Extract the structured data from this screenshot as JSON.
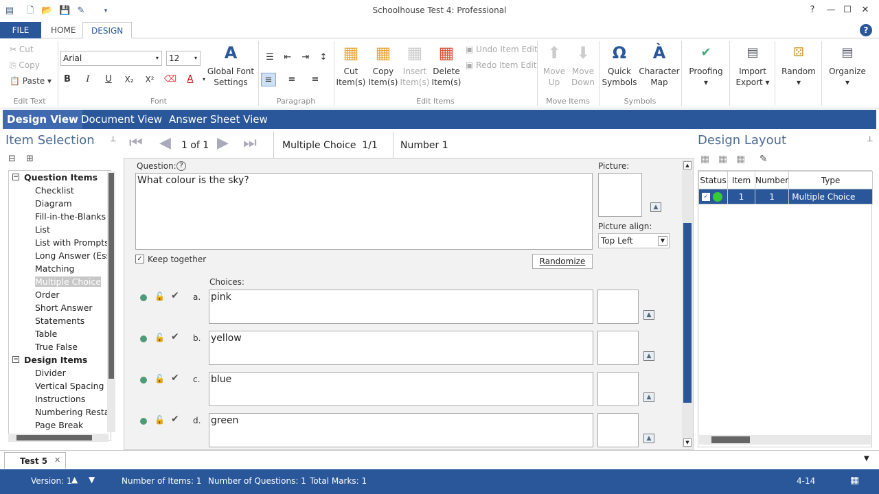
{
  "app": {
    "title": "Schoolhouse Test 4: Professional"
  },
  "ribbon_tabs": [
    "FILE",
    "HOME",
    "DESIGN"
  ],
  "ribbon": {
    "edit_text": {
      "label": "Edit Text",
      "cut": "Cut",
      "copy": "Copy",
      "paste": "Paste"
    },
    "font": {
      "label": "Font",
      "family": "Arial",
      "size": "12",
      "global_settings": "Global Font Settings"
    },
    "paragraph": {
      "label": "Paragraph"
    },
    "edit_items": {
      "label": "Edit Items",
      "cut": "Cut Item(s)",
      "copy": "Copy Item(s)",
      "insert": "Insert Item(s)",
      "delete": "Delete Item(s)",
      "undo": "Undo Item Edit",
      "redo": "Redo Item Edit"
    },
    "move_items": {
      "label": "Move Items",
      "up": "Move Up",
      "down": "Move Down"
    },
    "symbols": {
      "label": "Symbols",
      "quick": "Quick Symbols",
      "charmap": "Character Map"
    },
    "proofing": "Proofing",
    "import_export": "Import Export",
    "random": "Random",
    "organize": "Organize"
  },
  "view_tabs": [
    "Design View",
    "Document View",
    "Answer Sheet View"
  ],
  "item_selection": {
    "title": "Item Selection",
    "tree": [
      {
        "type": "cat",
        "label": "Question Items"
      },
      {
        "type": "leaf",
        "label": "Checklist"
      },
      {
        "type": "leaf",
        "label": "Diagram"
      },
      {
        "type": "leaf",
        "label": "Fill-in-the-Blanks"
      },
      {
        "type": "leaf",
        "label": "List"
      },
      {
        "type": "leaf",
        "label": "List with Prompts"
      },
      {
        "type": "leaf",
        "label": "Long Answer (Essa"
      },
      {
        "type": "leaf",
        "label": "Matching"
      },
      {
        "type": "leaf",
        "label": "Multiple Choice",
        "selected": true
      },
      {
        "type": "leaf",
        "label": "Order"
      },
      {
        "type": "leaf",
        "label": "Short Answer"
      },
      {
        "type": "leaf",
        "label": "Statements"
      },
      {
        "type": "leaf",
        "label": "Table"
      },
      {
        "type": "leaf",
        "label": "True False"
      },
      {
        "type": "cat",
        "label": "Design Items"
      },
      {
        "type": "leaf",
        "label": "Divider"
      },
      {
        "type": "leaf",
        "label": "Vertical Spacing"
      },
      {
        "type": "leaf",
        "label": "Instructions"
      },
      {
        "type": "leaf",
        "label": "Numbering Restar"
      },
      {
        "type": "leaf",
        "label": "Page Break"
      }
    ]
  },
  "nav": {
    "position": "1 of 1",
    "item_type": "Multiple Choice  1/1",
    "number": "Number 1"
  },
  "editor": {
    "question_label": "Question:",
    "question_text": "What colour is the sky?",
    "picture_label": "Picture:",
    "picture_align_label": "Picture align:",
    "picture_align_value": "Top Left",
    "keep_together": "Keep together",
    "randomize": "Randomize",
    "choices_label": "Choices:",
    "choices": [
      {
        "letter": "a.",
        "text": "pink"
      },
      {
        "letter": "b.",
        "text": "yellow"
      },
      {
        "letter": "c.",
        "text": "blue"
      },
      {
        "letter": "d.",
        "text": "green"
      }
    ]
  },
  "design_layout": {
    "title": "Design Layout",
    "columns": [
      "Status",
      "Item",
      "Number",
      "Type"
    ],
    "rows": [
      {
        "item": "1",
        "number": "1",
        "type": "Multiple Choice"
      }
    ]
  },
  "doc_tab": "Test 5",
  "status": {
    "version": "Version: 1",
    "items": "Number of Items: 1",
    "questions": "Number of Questions: 1",
    "marks": "Total Marks: 1",
    "right": "4-14"
  },
  "colors": {
    "accent": "#2a579a",
    "status_ok": "#33cc33"
  }
}
